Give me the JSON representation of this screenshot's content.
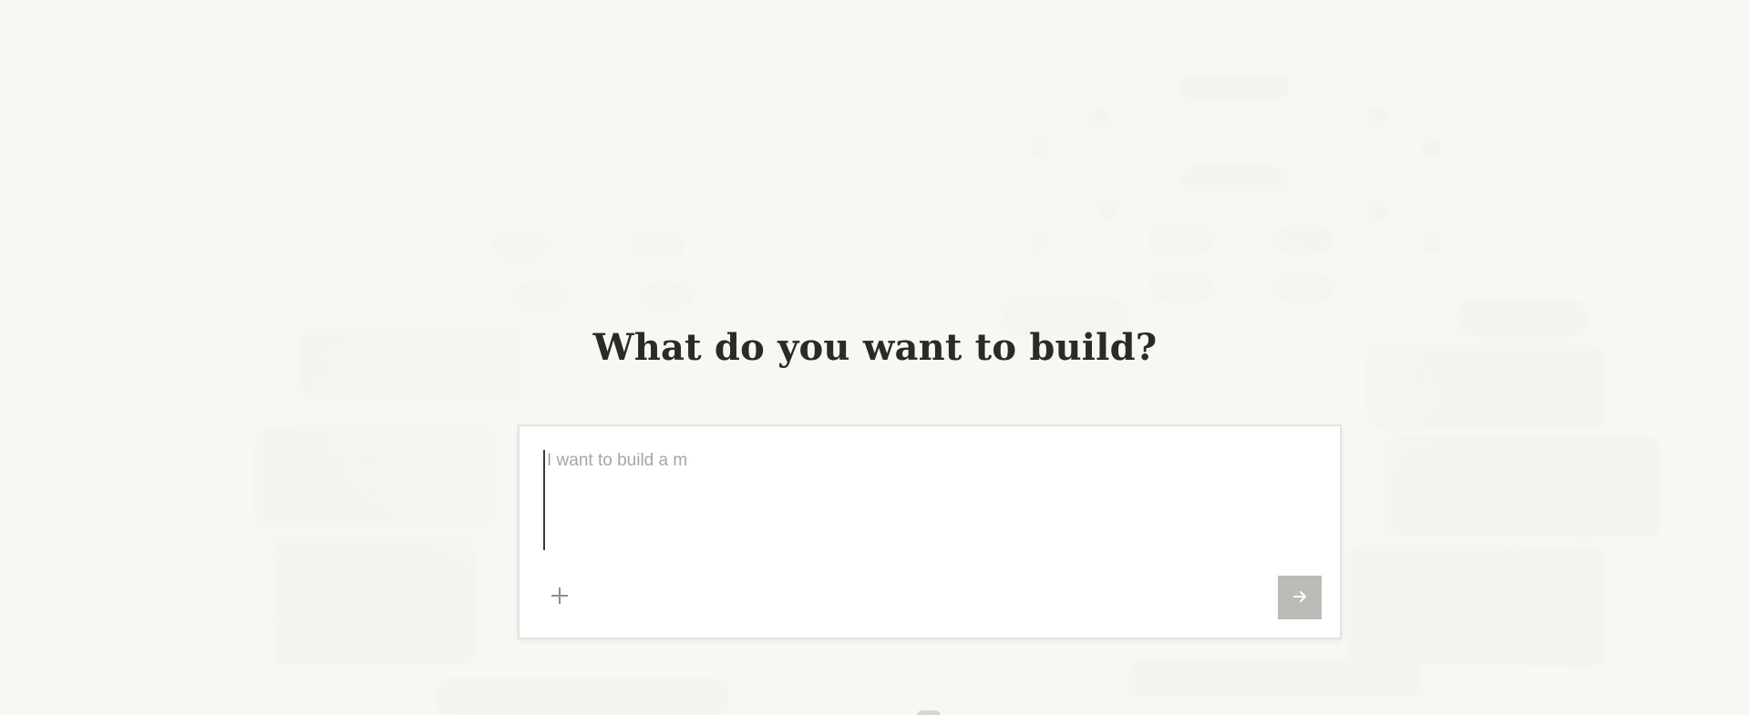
{
  "main": {
    "headline": "What do you want to build?",
    "prompt": {
      "placeholder": "I want to build a m",
      "value": ""
    },
    "add_icon": "plus-icon",
    "submit_icon": "arrow-right-icon"
  },
  "colors": {
    "background": "#f8f7f4",
    "headline": "#2b2a28",
    "card": "#ffffff",
    "card_border": "#e6e3dd",
    "submit_button": "#bdbbb7",
    "placeholder": "#a8a6a1"
  }
}
